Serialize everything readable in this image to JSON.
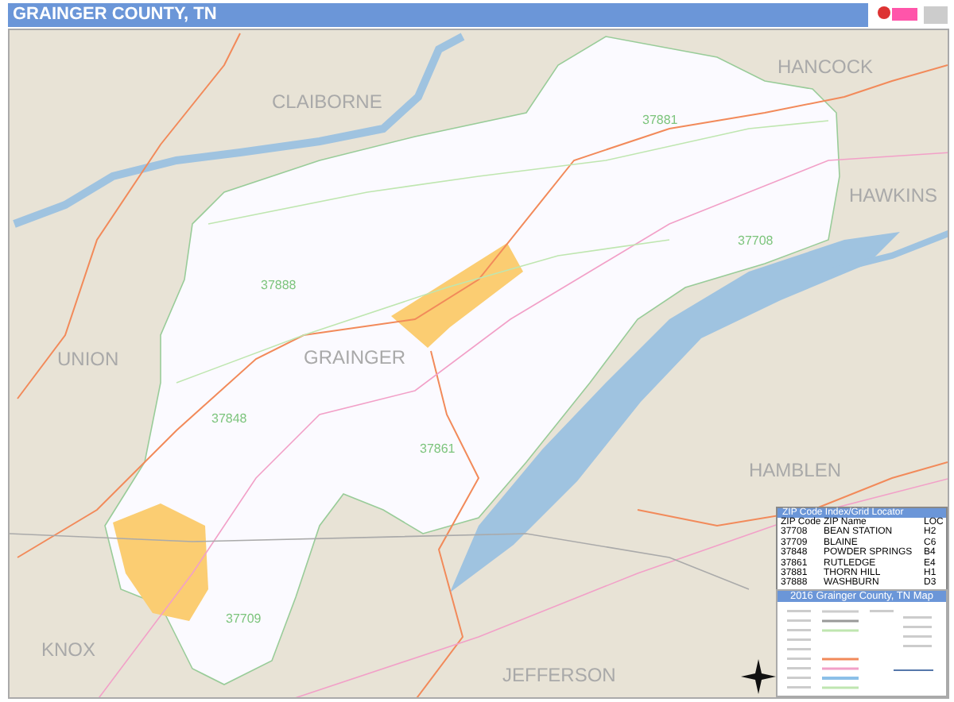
{
  "header": {
    "title": "GRAINGER COUNTY, TN"
  },
  "map": {
    "county_labels": [
      "CLAIBORNE",
      "HANCOCK",
      "HAWKINS",
      "UNION",
      "GRAINGER",
      "HAMBLEN",
      "KNOX",
      "JEFFERSON"
    ],
    "zip_labels": [
      "37881",
      "37708",
      "37888",
      "37848",
      "37861",
      "37709"
    ]
  },
  "zip_index": {
    "title": "ZIP Code Index/Grid Locator",
    "columns": [
      "ZIP Code",
      "ZIP Name",
      "LOC"
    ],
    "rows": [
      [
        "37708",
        "BEAN STATION",
        "H2"
      ],
      [
        "37709",
        "BLAINE",
        "C6"
      ],
      [
        "37848",
        "POWDER SPRINGS",
        "B4"
      ],
      [
        "37861",
        "RUTLEDGE",
        "E4"
      ],
      [
        "37881",
        "THORN HILL",
        "H1"
      ],
      [
        "37888",
        "WASHBURN",
        "D3"
      ]
    ]
  },
  "legend": {
    "title": "2016 Grainger County, TN Map"
  }
}
